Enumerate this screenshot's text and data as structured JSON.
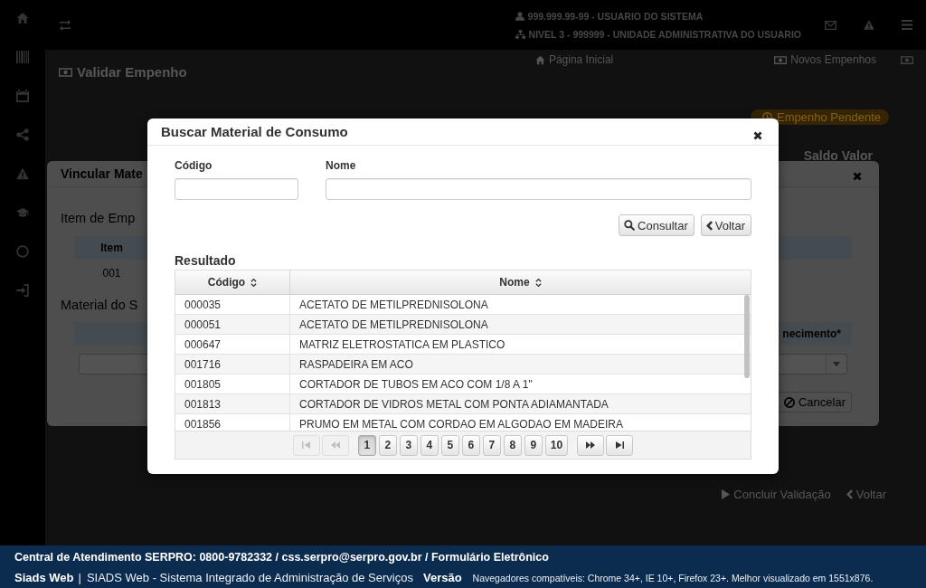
{
  "header": {
    "user": "999.999.99-99 - USUARIO DO SISTEMA",
    "unit": "NIVEL 3 - 999999 - UNIDADE ADMINISTRATIVA DO USUARIO"
  },
  "breadcrumb": [
    {
      "label": "Página Inicial",
      "kind": "home"
    },
    {
      "label": "Novos Empenhos",
      "kind": "money"
    }
  ],
  "page": {
    "title": "Validar Empenho",
    "status": "Empenho Pendente",
    "column_heading": "Saldo Valor",
    "actions": [
      {
        "label": "Concluir Validação",
        "kind": "confirm"
      },
      {
        "label": "Voltar",
        "kind": "back"
      }
    ]
  },
  "link_dialog": {
    "title": "Vincular Mate",
    "item_section": "Item de Emp",
    "item_table": {
      "columns": [
        "Item"
      ],
      "rows": [
        [
          "001"
        ]
      ]
    },
    "material_section": "Material do S",
    "material_table": {
      "columns": [
        "necimento*"
      ]
    },
    "buttons": [
      {
        "label": "Cancelar",
        "kind": "cancel"
      }
    ]
  },
  "search_dialog": {
    "title": "Buscar Material de Consumo",
    "fields": [
      {
        "label": "Código"
      },
      {
        "label": "Nome"
      }
    ],
    "buttons": [
      {
        "label": "Consultar",
        "kind": "search"
      },
      {
        "label": "Voltar",
        "kind": "back"
      }
    ],
    "result_heading": "Resultado",
    "table": {
      "columns": [
        {
          "label": "Código",
          "sortable": true
        },
        {
          "label": "Nome",
          "sortable": true
        }
      ],
      "rows": [
        [
          "000035",
          "ACETATO DE METILPREDNISOLONA"
        ],
        [
          "000051",
          "ACETATO DE METILPREDNISOLONA"
        ],
        [
          "000647",
          "MATRIZ ELETROSTATICA EM PLASTICO"
        ],
        [
          "001716",
          "RASPADEIRA EM ACO"
        ],
        [
          "001805",
          "CORTADOR DE TUBOS EM ACO COM 1/8 A 1\""
        ],
        [
          "001813",
          "CORTADOR DE VIDROS METAL COM PONTA ADIAMANTADA"
        ],
        [
          "001856",
          "PRUMO EM METAL COM CORDAO EM ALGODAO EM MADEIRA"
        ]
      ]
    },
    "pager": {
      "back": [
        {
          "kind": "first",
          "disabled": true
        },
        {
          "kind": "previous",
          "disabled": true
        }
      ],
      "pages": [
        {
          "label": "1",
          "selected": true
        },
        {
          "label": "2",
          "selected": false
        },
        {
          "label": "3",
          "selected": false
        },
        {
          "label": "4",
          "selected": false
        },
        {
          "label": "5",
          "selected": false
        },
        {
          "label": "6",
          "selected": false
        },
        {
          "label": "7",
          "selected": false
        },
        {
          "label": "8",
          "selected": false
        },
        {
          "label": "9",
          "selected": false
        },
        {
          "label": "10",
          "selected": false
        }
      ],
      "forward": [
        {
          "kind": "next",
          "disabled": false
        },
        {
          "kind": "last",
          "disabled": false
        }
      ]
    }
  },
  "footer": {
    "contact": "Central de Atendimento SERPRO: 0800-9782332 / css.serpro@serpro.gov.br / Formulário Eletrônico",
    "app_name": "Siads Web",
    "separator": "|",
    "app_full_name": "SIADS Web - Sistema Integrado de Administração de Serviços",
    "version_label": "Versão",
    "browsers_note": "Navegadores compatíveis: Chrome 34+, IE 10+, Firefox 23+. Melhor visualizado em 1551x876."
  }
}
